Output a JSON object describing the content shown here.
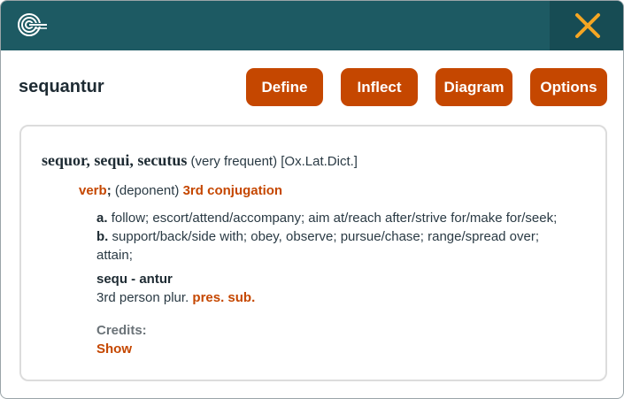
{
  "header": {
    "logo_icon": "spiral-logo",
    "close_icon": "close-x",
    "brand_color": "#1d5a63",
    "close_color": "#f5a623"
  },
  "word": "sequantur",
  "buttons": {
    "define": "Define",
    "inflect": "Inflect",
    "diagram": "Diagram",
    "options": "Options",
    "color": "#c54700"
  },
  "entry": {
    "lemma": "sequor, sequi, secutus",
    "frequency": "(very frequent)",
    "source": "[Ox.Lat.Dict.]",
    "pos": "verb",
    "pos_sep": ";",
    "deponent": "(deponent)",
    "conjugation": "3rd conjugation",
    "senses": [
      {
        "marker": "a.",
        "text": "follow; escort/attend/accompany; aim at/reach after/strive for/make for/seek;"
      },
      {
        "marker": "b.",
        "text": "support/back/side with; obey, observe; pursue/chase; range/spread over; attain;"
      }
    ]
  },
  "form": {
    "title": "sequ - antur",
    "description": "3rd person plur.",
    "tense": "pres. sub."
  },
  "credits": {
    "label": "Credits:",
    "link": "Show"
  }
}
